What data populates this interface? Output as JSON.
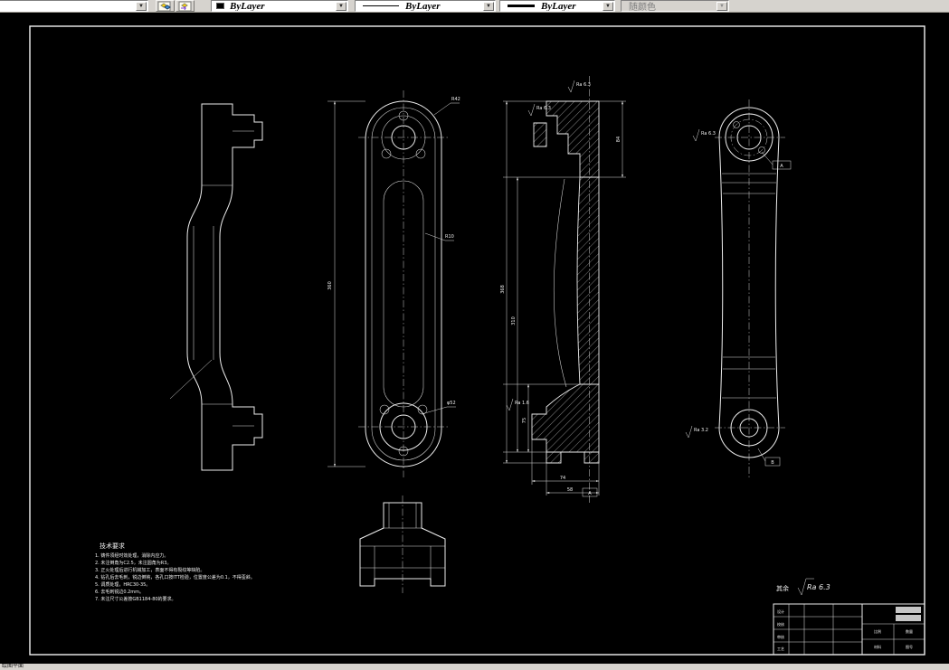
{
  "toolbar": {
    "color": "ByLayer",
    "linetype": "ByLayer",
    "lineweight": "ByLayer",
    "plot_style": "随颜色",
    "arrow_glyph": "▼"
  },
  "colors": {
    "canvas_bg": "#000000",
    "line": "#ededed",
    "toolbar_bg": "#d6d3ce"
  },
  "drawing": {
    "tech": {
      "title": "技术要求",
      "items": [
        "1. 铸件须经时效处理，消除内应力。",
        "2. 未注倒角为C2.5，未注圆角为R3。",
        "3. 正火处理后进行机械加工，表面不得有裂纹等缺陷。",
        "4. 钻孔后去毛刺，锐边倒钝，各孔口按ITT检验，位置度公差为0.1，不得歪斜。",
        "5. 调质处理，HRC30-35。",
        "6. 去毛刺锐边0.2mm。",
        "7. 未注尺寸公差按GB1184-80的要求。"
      ]
    },
    "surface_note": {
      "prefix": "其余",
      "value": "Ra 6.3"
    },
    "dims": {
      "front_height": "360",
      "front_r_top": "R42",
      "front_r_mid": "R10",
      "front_d_bottom": "φ52",
      "sec_h1": "368",
      "sec_h2": "310",
      "sec_h3": "75",
      "sec_w1": "74",
      "sec_w2": "58",
      "sec_right": "84",
      "ra63": "Ra 6.3",
      "ra32": "Ra 3.2",
      "ra16": "Ra 1.6",
      "datum_a": "A",
      "datum_b": "B"
    },
    "title_block": {
      "cells": [
        "设计",
        "校核",
        "审核",
        "工艺"
      ],
      "labels": [
        "比例",
        "数量",
        "材料",
        "图号"
      ]
    }
  },
  "statusbar": {
    "text": "绘图平面"
  }
}
